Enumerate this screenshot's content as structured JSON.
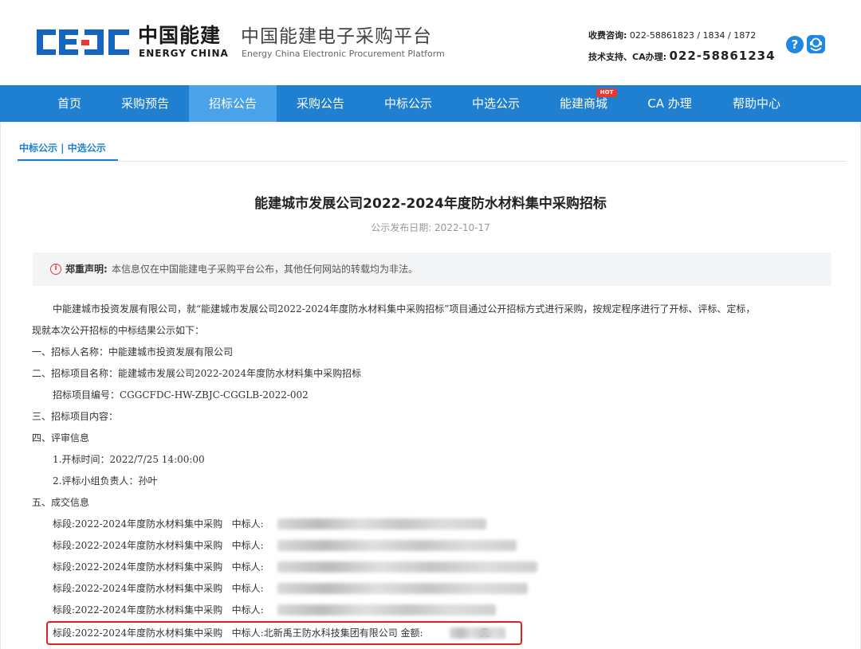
{
  "header": {
    "logo_cn": "中国能建",
    "logo_en": "ENERGY CHINA",
    "logo_letters": "CEEC",
    "platform_cn": "中国能建电子采购平台",
    "platform_en": "Energy China Electronic Procurement Platform",
    "contact_fee_label": "收费咨询:",
    "contact_fee_value": "022-58861823 / 1834 / 1872",
    "contact_support_label": "技术支持、CA办理:",
    "contact_support_value": "022-58861234",
    "help_icon_glyph": "?"
  },
  "nav": {
    "items": [
      "首页",
      "采购预告",
      "招标公告",
      "采购公告",
      "中标公示",
      "中选公示",
      "能建商城",
      "CA 办理",
      "帮助中心"
    ],
    "active_index": 2,
    "hot_badge": "HOT"
  },
  "subtab": {
    "label": "中标公示 | 中选公示"
  },
  "article": {
    "title": "能建城市发展公司2022-2024年度防水材料集中采购招标",
    "date": "公示发布日期: 2022-10-17",
    "notice_label": "郑重声明:",
    "notice_text": "本信息仅在中国能建电子采购平台公布，其他任何网站的转载均为非法。",
    "intro_line1": "中能建城市投资发展有限公司，就“能建城市发展公司2022-2024年度防水材料集中采购招标”项目通过公开招标方式进行采购，按规定程序进行了开标、评标、定标，",
    "intro_line2": "现就本次公开招标的中标结果公示如下：",
    "s1": "一、招标人名称：中能建城市投资发展有限公司",
    "s2": "二、招标项目名称：能建城市发展公司2022-2024年度防水材料集中采购招标",
    "s2_code": "招标项目编号：CGGCFDC-HW-ZBJC-CGGLB-2022-002",
    "s3": "三、招标项目内容：",
    "s4": "四、评审信息",
    "s4_1": "1.开标时间：2022/7/25 14:00:00",
    "s4_2": "2.评标小组负责人：孙叶",
    "s5": "五、成交信息",
    "lot_text": "标段:2022-2024年度防水材料集中采购",
    "winner_label": "中标人:",
    "last_winner": "北新禹王防水科技集团有限公司",
    "amount_label": "金额:",
    "amount_unit": "元"
  },
  "colors": {
    "brand_blue": "#1f7fd1",
    "nav_active": "#4aa3e8",
    "highlight_red": "#e02020"
  }
}
